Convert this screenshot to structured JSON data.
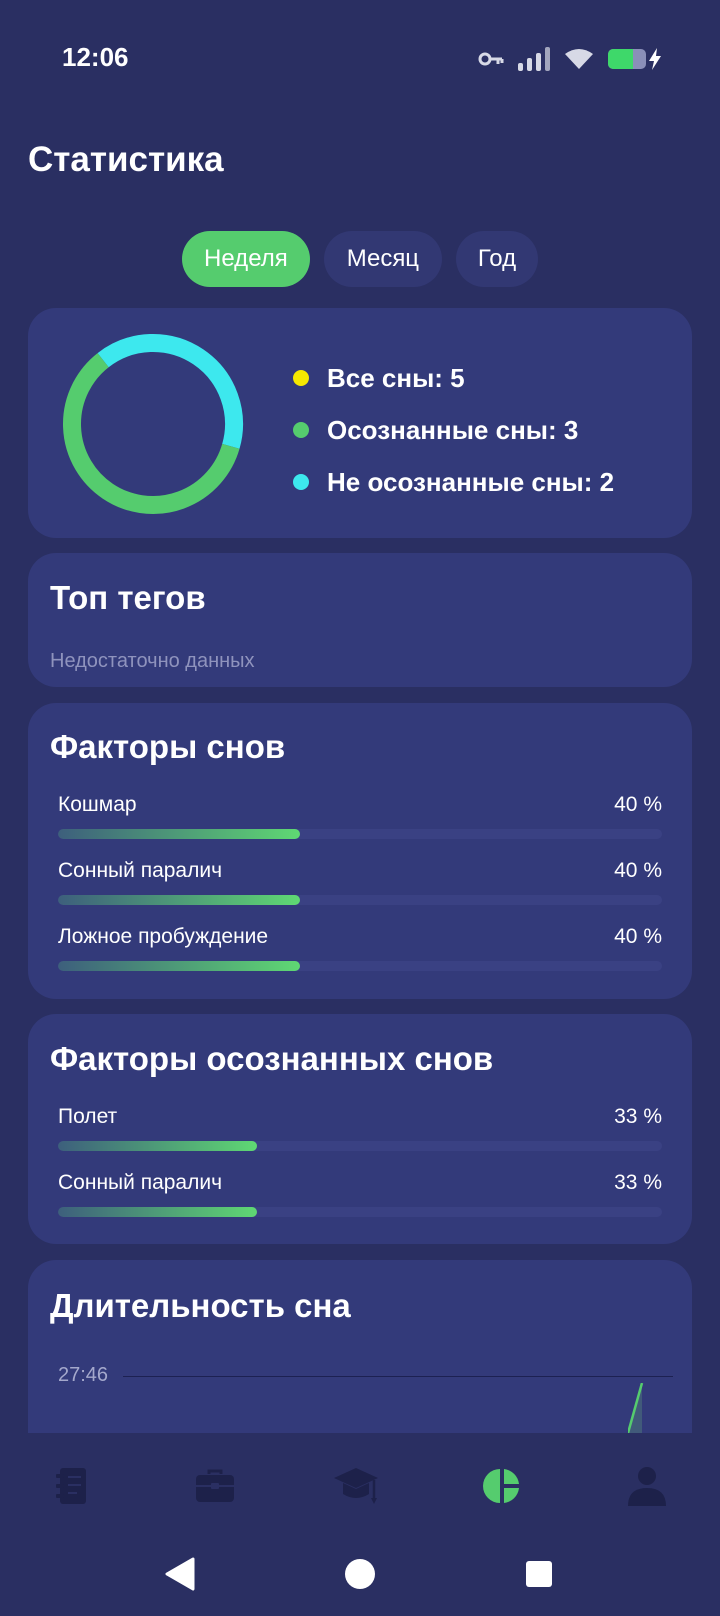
{
  "status": {
    "time": "12:06",
    "icons": [
      "key-icon",
      "signal-icon",
      "wifi-icon",
      "battery-icon",
      "charging-icon"
    ],
    "battery_level": 0.65
  },
  "page": {
    "title": "Статистика"
  },
  "period_tabs": {
    "items": [
      "Неделя",
      "Месяц",
      "Год"
    ],
    "active": 0
  },
  "summary": {
    "items": [
      {
        "label": "Все сны: 5",
        "color": "#f6e800"
      },
      {
        "label": "Осознанные сны: 3",
        "color": "#55cc6e"
      },
      {
        "label": "Не осознанные сны: 2",
        "color": "#3de8ee"
      }
    ]
  },
  "chart_data": {
    "type": "pie",
    "categories": [
      "Осознанные сны",
      "Не осознанные сны"
    ],
    "values": [
      3,
      2
    ],
    "colors": [
      "#55cc6e",
      "#3de8ee"
    ]
  },
  "top_tags": {
    "title": "Топ тегов",
    "empty_text": "Недостаточно данных"
  },
  "dream_factors": {
    "title": "Факторы снов",
    "items": [
      {
        "name": "Кошмар",
        "percent_text": "40 %",
        "value": 40
      },
      {
        "name": "Сонный паралич",
        "percent_text": "40 %",
        "value": 40
      },
      {
        "name": "Ложное пробуждение",
        "percent_text": "40 %",
        "value": 40
      }
    ]
  },
  "lucid_factors": {
    "title": "Факторы осознанных снов",
    "items": [
      {
        "name": "Полет",
        "percent_text": "33 %",
        "value": 33
      },
      {
        "name": "Сонный паралич",
        "percent_text": "33 %",
        "value": 33
      }
    ]
  },
  "sleep_duration": {
    "title": "Длительность сна",
    "y_max_label": "27:46"
  },
  "bottom_nav": {
    "items": [
      "journal-icon",
      "toolbox-icon",
      "graduation-cap-icon",
      "statistics-icon",
      "profile-icon"
    ],
    "active": 3,
    "active_color": "#55cc6e",
    "inactive_color": "#1d214a"
  },
  "system_nav": {
    "items": [
      "back-icon",
      "home-icon",
      "recents-icon"
    ]
  }
}
